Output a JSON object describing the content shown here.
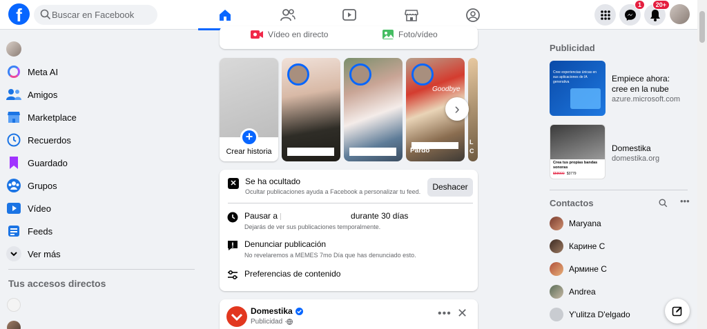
{
  "search": {
    "placeholder": "Buscar en Facebook"
  },
  "topnav": [
    {
      "name": "home"
    },
    {
      "name": "friends"
    },
    {
      "name": "video"
    },
    {
      "name": "marketplace"
    },
    {
      "name": "groups"
    }
  ],
  "header": {
    "messenger_badge": "1",
    "notifications_badge": "20+"
  },
  "composer": {
    "live_video": "Vídeo en directo",
    "photo_video": "Foto/vídeo"
  },
  "sidebar": {
    "items": [
      {
        "label": "Meta AI"
      },
      {
        "label": "Amigos"
      },
      {
        "label": "Marketplace"
      },
      {
        "label": "Recuerdos"
      },
      {
        "label": "Guardado"
      },
      {
        "label": "Grupos"
      },
      {
        "label": "Vídeo"
      },
      {
        "label": "Feeds"
      },
      {
        "label": "Ver más"
      }
    ],
    "shortcuts_title": "Tus accesos directos"
  },
  "stories": {
    "create_label": "Crear historia",
    "story3_text": "Goodbye",
    "story3_bottom": "Pardo",
    "story4_partial": "L C"
  },
  "hidden_post": {
    "title": "Se ha ocultado",
    "subtitle": "Ocultar publicaciones ayuda a Facebook a personalizar tu feed.",
    "undo": "Deshacer",
    "options": [
      {
        "title_prefix": "Pausar a",
        "title_suffix": "durante 30 días",
        "subtitle": "Dejarás de ver sus publicaciones temporalmente."
      },
      {
        "title": "Denunciar publicación",
        "subtitle": "No revelaremos a MEMES 7mo Día que has denunciado esto."
      },
      {
        "title": "Preferencias de contenido"
      }
    ]
  },
  "ad_post": {
    "name": "Domestika",
    "meta": "Publicidad · "
  },
  "ads": {
    "title": "Publicidad",
    "items": [
      {
        "headline": "Empiece ahora: cree en la nube",
        "domain": "azure.microsoft.com",
        "image_text": "Cree experiencias únicas en sus aplicaciones de IA generativa"
      },
      {
        "headline": "Domestika",
        "domain": "domestika.org",
        "image_text": "Crea tus propias bandas sonoras",
        "price_old": "$58900",
        "price_new": "$3779"
      }
    ]
  },
  "contacts": {
    "title": "Contactos",
    "items": [
      {
        "name": "Maryana"
      },
      {
        "name": "Карине С"
      },
      {
        "name": "Армине С"
      },
      {
        "name": "Andrea"
      },
      {
        "name": "Y'ulitza D'elgado"
      }
    ]
  },
  "colors": {
    "brand": "#0866ff",
    "badge": "#e41e3f"
  }
}
